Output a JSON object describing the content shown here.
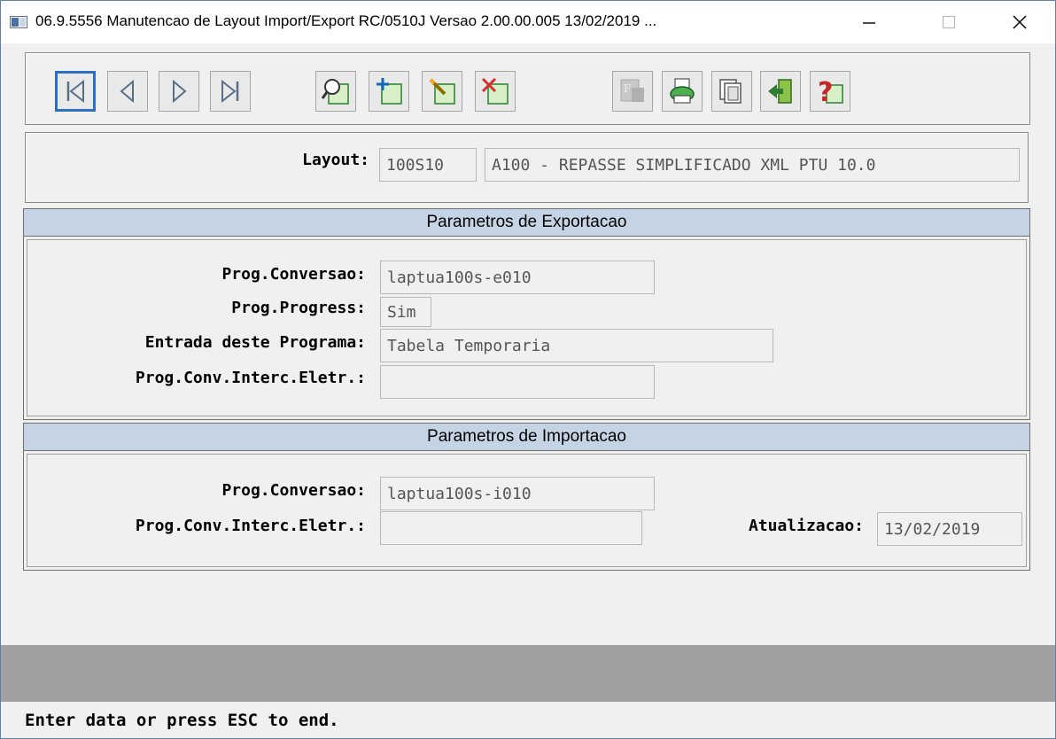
{
  "window": {
    "title": "06.9.5556 Manutencao  de Layout Import/Export RC/0510J Versao 2.00.00.005 13/02/2019 ...",
    "controls": [
      "minimize",
      "maximize",
      "close"
    ]
  },
  "toolbar": {
    "buttons": [
      {
        "name": "first-record",
        "icon": "first-record-icon",
        "focused": true
      },
      {
        "name": "previous-record",
        "icon": "previous-icon"
      },
      {
        "name": "next-record",
        "icon": "next-icon"
      },
      {
        "name": "last-record",
        "icon": "last-record-icon"
      },
      {
        "name": "search",
        "icon": "search-icon"
      },
      {
        "name": "add",
        "icon": "add-icon"
      },
      {
        "name": "edit",
        "icon": "edit-icon"
      },
      {
        "name": "delete",
        "icon": "delete-icon"
      },
      {
        "name": "filter",
        "icon": "filter-icon",
        "disabled": true
      },
      {
        "name": "print",
        "icon": "print-icon"
      },
      {
        "name": "copy",
        "icon": "copy-icon"
      },
      {
        "name": "exit",
        "icon": "exit-icon"
      },
      {
        "name": "help",
        "icon": "help-icon"
      }
    ]
  },
  "layout": {
    "label": "Layout:",
    "code": "100S10",
    "description": "A100 - REPASSE SIMPLIFICADO XML PTU 10.0"
  },
  "export": {
    "header": "Parametros de Exportacao",
    "prog_conversao_label": "Prog.Conversao:",
    "prog_conversao_value": "laptua100s-e010",
    "prog_progress_label": "Prog.Progress:",
    "prog_progress_value": "Sim",
    "entrada_label": "Entrada deste Programa:",
    "entrada_value": "Tabela Temporaria",
    "interc_label": "Prog.Conv.Interc.Eletr.:",
    "interc_value": ""
  },
  "import": {
    "header": "Parametros de Importacao",
    "prog_conversao_label": "Prog.Conversao:",
    "prog_conversao_value": "laptua100s-i010",
    "interc_label": "Prog.Conv.Interc.Eletr.:",
    "interc_value": "",
    "atualizacao_label": "Atualizacao:",
    "atualizacao_value": "13/02/2019"
  },
  "status": {
    "message": "Enter data or press ESC to end."
  },
  "colors": {
    "section_header_bg": "#c5d4e4",
    "focus_border": "#2f6fc1",
    "status_area": "#a0a0a0"
  }
}
